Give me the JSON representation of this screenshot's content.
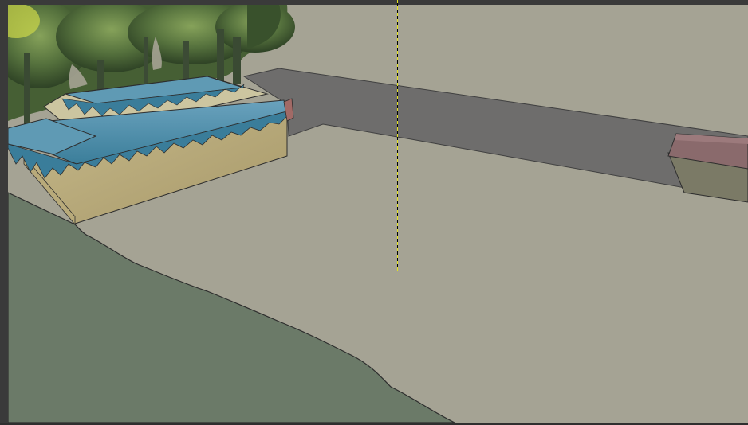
{
  "app": {
    "view": "image-editor-canvas"
  },
  "canvas": {
    "background_color": "#a5a394",
    "frame_color": "#3a3a3a"
  },
  "artwork": {
    "description_colors": {
      "sky": "#a5a394",
      "trees": "#4f6b3c",
      "road": "#6e6d6c",
      "lawn": "#6b7a68",
      "building_wall": "#b8aa7a",
      "roof": "#4a8aa6",
      "small_building_roof": "#8a6a6c"
    }
  },
  "selection": {
    "style": "dashed-yellow-black"
  }
}
